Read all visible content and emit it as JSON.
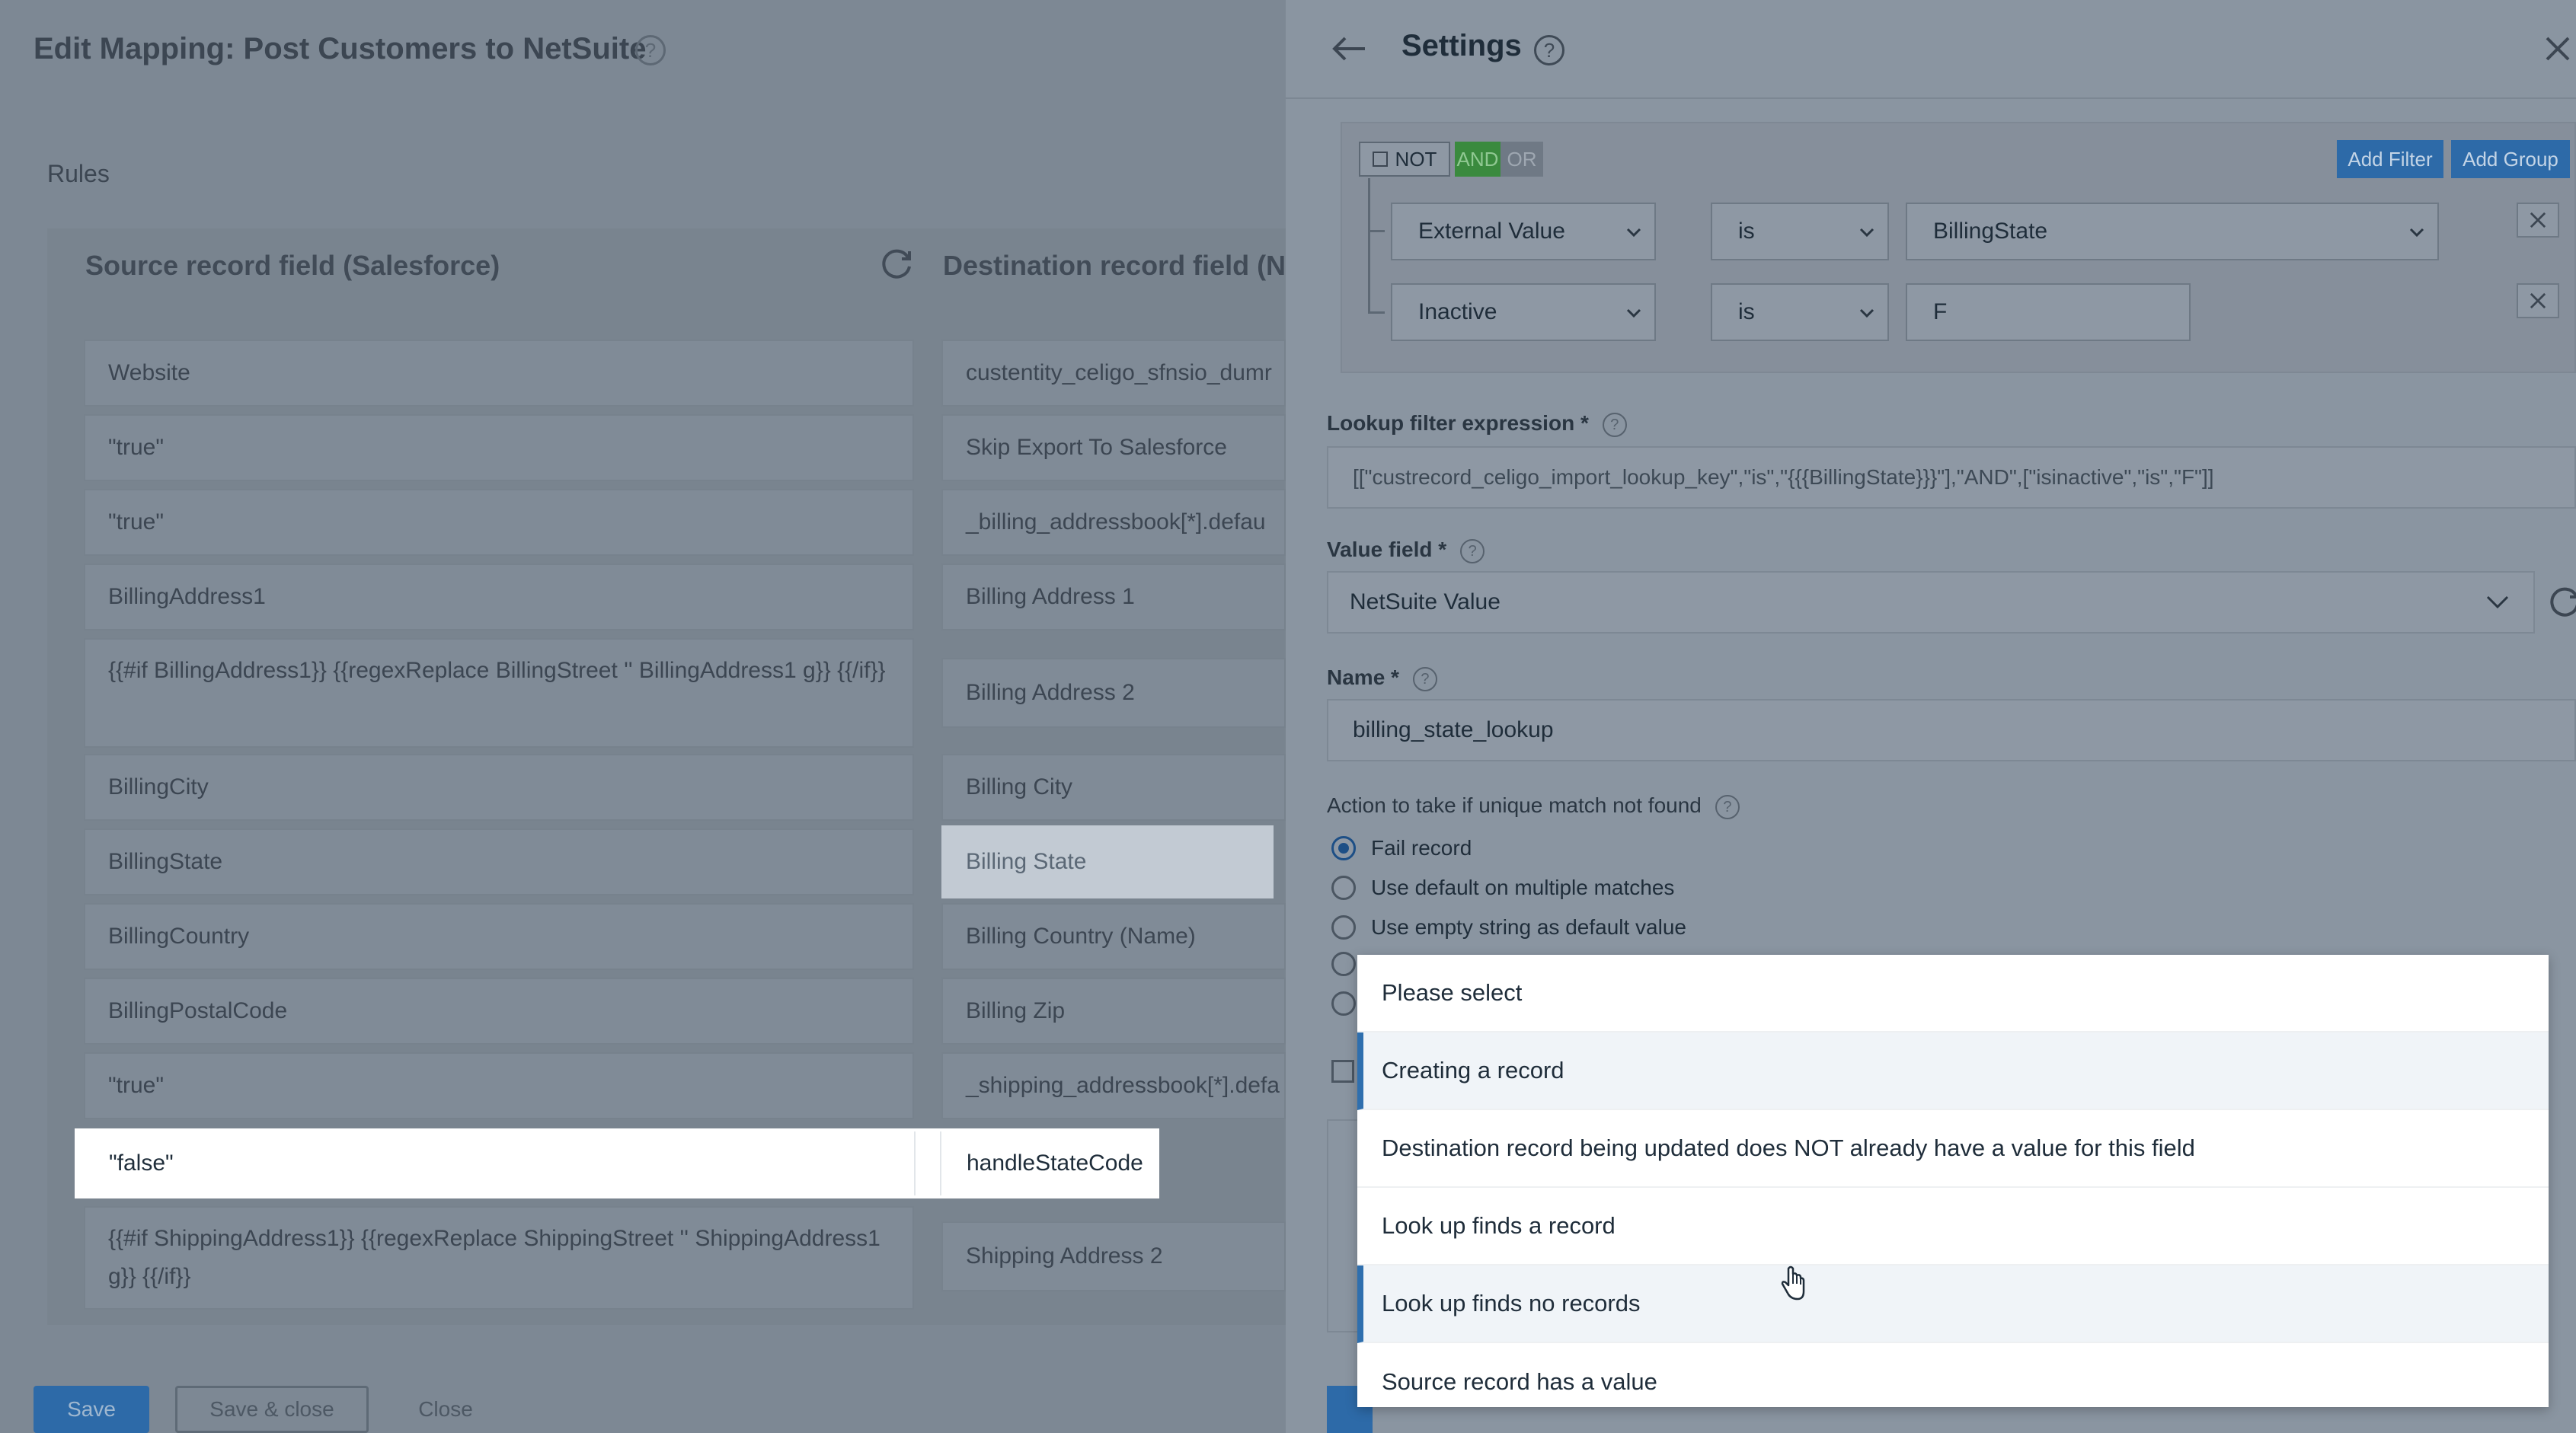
{
  "mapping": {
    "title": "Edit Mapping: Post Customers to NetSuite",
    "rules_label": "Rules",
    "source_header": "Source record field (Salesforce)",
    "destination_header": "Destination record field (Ne",
    "rows": [
      {
        "source": "Website",
        "destination": "custentity_celigo_sfnsio_dumr"
      },
      {
        "source": "\"true\"",
        "destination": "Skip Export To Salesforce"
      },
      {
        "source": "\"true\"",
        "destination": "_billing_addressbook[*].defau"
      },
      {
        "source": "BillingAddress1",
        "destination": "Billing Address 1"
      },
      {
        "source": "{{#if BillingAddress1}} {{regexReplace BillingStreet '' BillingAddress1 g}} {{/if}}",
        "destination": "Billing Address 2"
      },
      {
        "source": "BillingCity",
        "destination": "Billing City"
      },
      {
        "source": "BillingState",
        "destination": "Billing State"
      },
      {
        "source": "BillingCountry",
        "destination": "Billing Country (Name)"
      },
      {
        "source": "BillingPostalCode",
        "destination": "Billing Zip"
      },
      {
        "source": "\"true\"",
        "destination": "_shipping_addressbook[*].defa"
      },
      {
        "source": "\"false\"",
        "destination": "handleStateCode"
      },
      {
        "source": "{{#if ShippingAddress1}} {{regexReplace ShippingStreet '' ShippingAddress1 g}} {{/if}}",
        "destination": "Shipping Address 2"
      }
    ],
    "buttons": {
      "save": "Save",
      "save_close": "Save & close",
      "close": "Close"
    }
  },
  "settings": {
    "title": "Settings",
    "filter": {
      "not_label": "NOT",
      "and_label": "AND",
      "or_label": "OR",
      "add_filter": "Add Filter",
      "add_group": "Add Group",
      "rows": [
        {
          "field": "External Value",
          "operator": "is",
          "value": "BillingState"
        },
        {
          "field": "Inactive",
          "operator": "is",
          "value": "F"
        }
      ]
    },
    "lookup_filter_label": "Lookup filter expression *",
    "lookup_filter_value": "[[\"custrecord_celigo_import_lookup_key\",\"is\",\"{{{BillingState}}}\"],\"AND\",[\"isinactive\",\"is\",\"F\"]]",
    "value_field_label": "Value field *",
    "value_field_value": "NetSuite Value",
    "name_label": "Name *",
    "name_value": "billing_state_lookup",
    "action_label": "Action to take if unique match not found",
    "actions": [
      {
        "label": "Fail record",
        "selected": true
      },
      {
        "label": "Use default on multiple matches",
        "selected": false
      },
      {
        "label": "Use empty string as default value",
        "selected": false
      }
    ]
  },
  "dropdown": {
    "options": [
      "Please select",
      "Creating a record",
      "Destination record being updated does NOT already have a value for this field",
      "Look up finds a record",
      "Look up finds no records",
      "Source record has a value"
    ],
    "hovered": [
      "Creating a record",
      "Look up finds no records"
    ]
  },
  "colors": {
    "accent": "#2d6aa8",
    "and_green": "#3a8a3e",
    "dropdown_highlight": "#2f6fae"
  }
}
